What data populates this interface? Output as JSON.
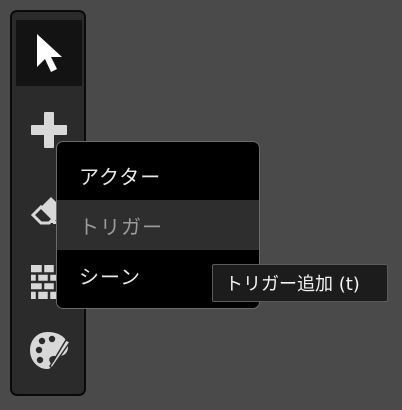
{
  "colors": {
    "background": "#4a4a4a",
    "toolbar_bg": "#2b2b2b",
    "tool_selected_bg": "#131313",
    "icon": "#d8d8d8",
    "menu_bg": "#000000",
    "menu_highlight": "#2e2e2e",
    "tooltip_bg": "#1c1c1c"
  },
  "toolbar": {
    "tools": [
      {
        "icon": "pointer-icon",
        "selected": true
      },
      {
        "icon": "plus-icon",
        "selected": false
      },
      {
        "icon": "eraser-icon",
        "selected": false
      },
      {
        "icon": "brick-wall-icon",
        "selected": false
      },
      {
        "icon": "palette-icon",
        "selected": false
      }
    ]
  },
  "add_menu": {
    "items": [
      {
        "label": "アクター",
        "highlighted": false
      },
      {
        "label": "トリガー",
        "highlighted": true
      },
      {
        "label": "シーン",
        "highlighted": false
      }
    ]
  },
  "tooltip": {
    "text": "トリガー追加 (t)"
  }
}
